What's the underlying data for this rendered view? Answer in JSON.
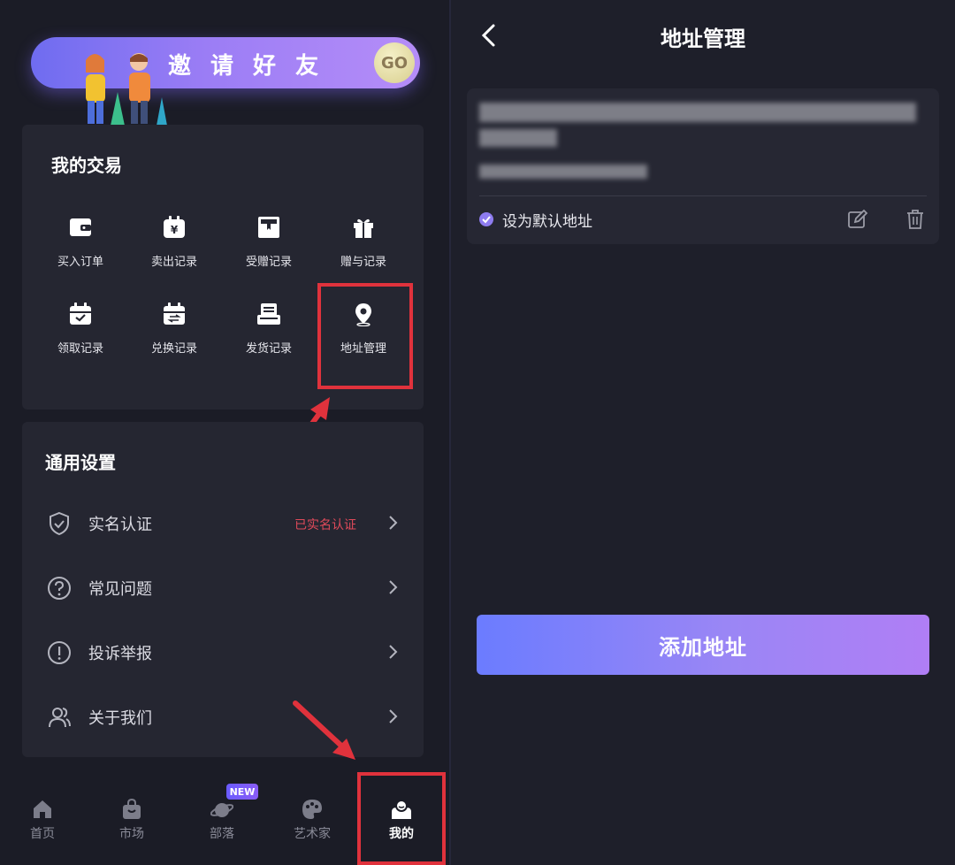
{
  "left": {
    "invite": {
      "text": "邀请好友",
      "go": "GO"
    },
    "trade": {
      "title": "我的交易",
      "items": [
        {
          "label": "买入订单",
          "icon": "wallet-icon"
        },
        {
          "label": "卖出记录",
          "icon": "yen-bag-icon"
        },
        {
          "label": "受赠记录",
          "icon": "gift-box-icon"
        },
        {
          "label": "赠与记录",
          "icon": "present-icon"
        },
        {
          "label": "领取记录",
          "icon": "calendar-check-icon"
        },
        {
          "label": "兑换记录",
          "icon": "calendar-exchange-icon"
        },
        {
          "label": "发货记录",
          "icon": "shipment-icon"
        },
        {
          "label": "地址管理",
          "icon": "location-pin-icon"
        }
      ]
    },
    "settings": {
      "title": "通用设置",
      "items": [
        {
          "label": "实名认证",
          "value": "已实名认证",
          "icon": "shield-check-icon"
        },
        {
          "label": "常见问题",
          "value": "",
          "icon": "question-circle-icon"
        },
        {
          "label": "投诉举报",
          "value": "",
          "icon": "exclamation-circle-icon"
        },
        {
          "label": "关于我们",
          "value": "",
          "icon": "users-icon"
        }
      ]
    },
    "tabs": [
      {
        "label": "首页",
        "icon": "home-icon"
      },
      {
        "label": "市场",
        "icon": "shopping-bag-icon"
      },
      {
        "label": "部落",
        "icon": "planet-icon",
        "badge": "NEW"
      },
      {
        "label": "艺术家",
        "icon": "palette-icon"
      },
      {
        "label": "我的",
        "icon": "profile-icon",
        "active": true
      }
    ]
  },
  "right": {
    "title": "地址管理",
    "address": {
      "default_label": "设为默认地址"
    },
    "add_button": "添加地址"
  },
  "colors": {
    "accent": "#8e7cf0",
    "highlight": "#e0323c",
    "verified": "#e04a5a"
  }
}
